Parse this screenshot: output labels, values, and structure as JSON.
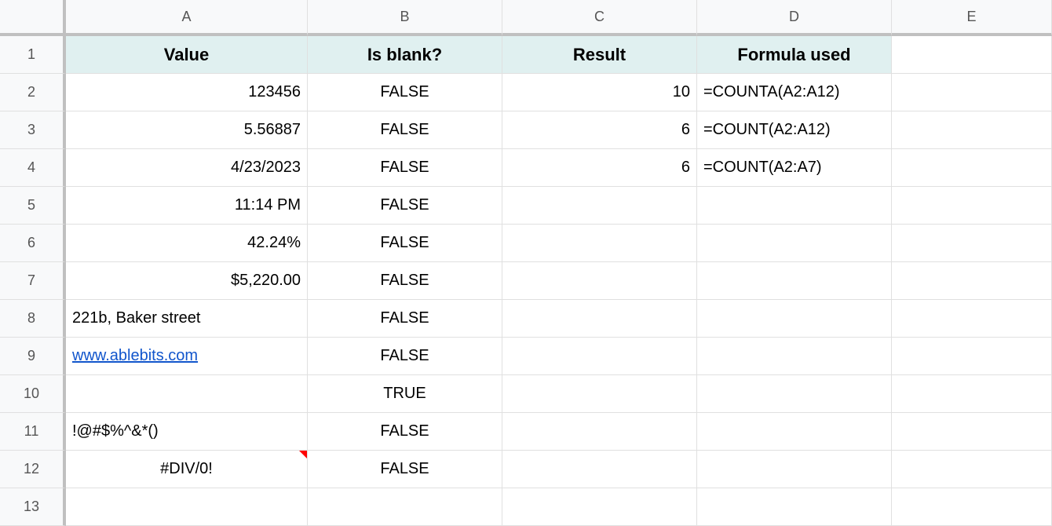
{
  "columns": [
    "A",
    "B",
    "C",
    "D",
    "E"
  ],
  "rowCount": 13,
  "headers": {
    "A": "Value",
    "B": "Is blank?",
    "C": "Result",
    "D": "Formula used"
  },
  "cells": {
    "A2": "123456",
    "A3": "5.56887",
    "A4": "4/23/2023",
    "A5": "11:14 PM",
    "A6": "42.24%",
    "A7": "$5,220.00",
    "A8": "221b, Baker street",
    "A9": "www.ablebits.com",
    "A10": "",
    "A11": "!@#$%^&*()",
    "A12": "#DIV/0!",
    "B2": "FALSE",
    "B3": "FALSE",
    "B4": "FALSE",
    "B5": "FALSE",
    "B6": "FALSE",
    "B7": "FALSE",
    "B8": "FALSE",
    "B9": "FALSE",
    "B10": "TRUE",
    "B11": "FALSE",
    "B12": "FALSE",
    "C2": "10",
    "C3": "6",
    "C4": "6",
    "D2": "=COUNTA(A2:A12)",
    "D3": "=COUNT(A2:A12)",
    "D4": "=COUNT(A2:A7)"
  }
}
